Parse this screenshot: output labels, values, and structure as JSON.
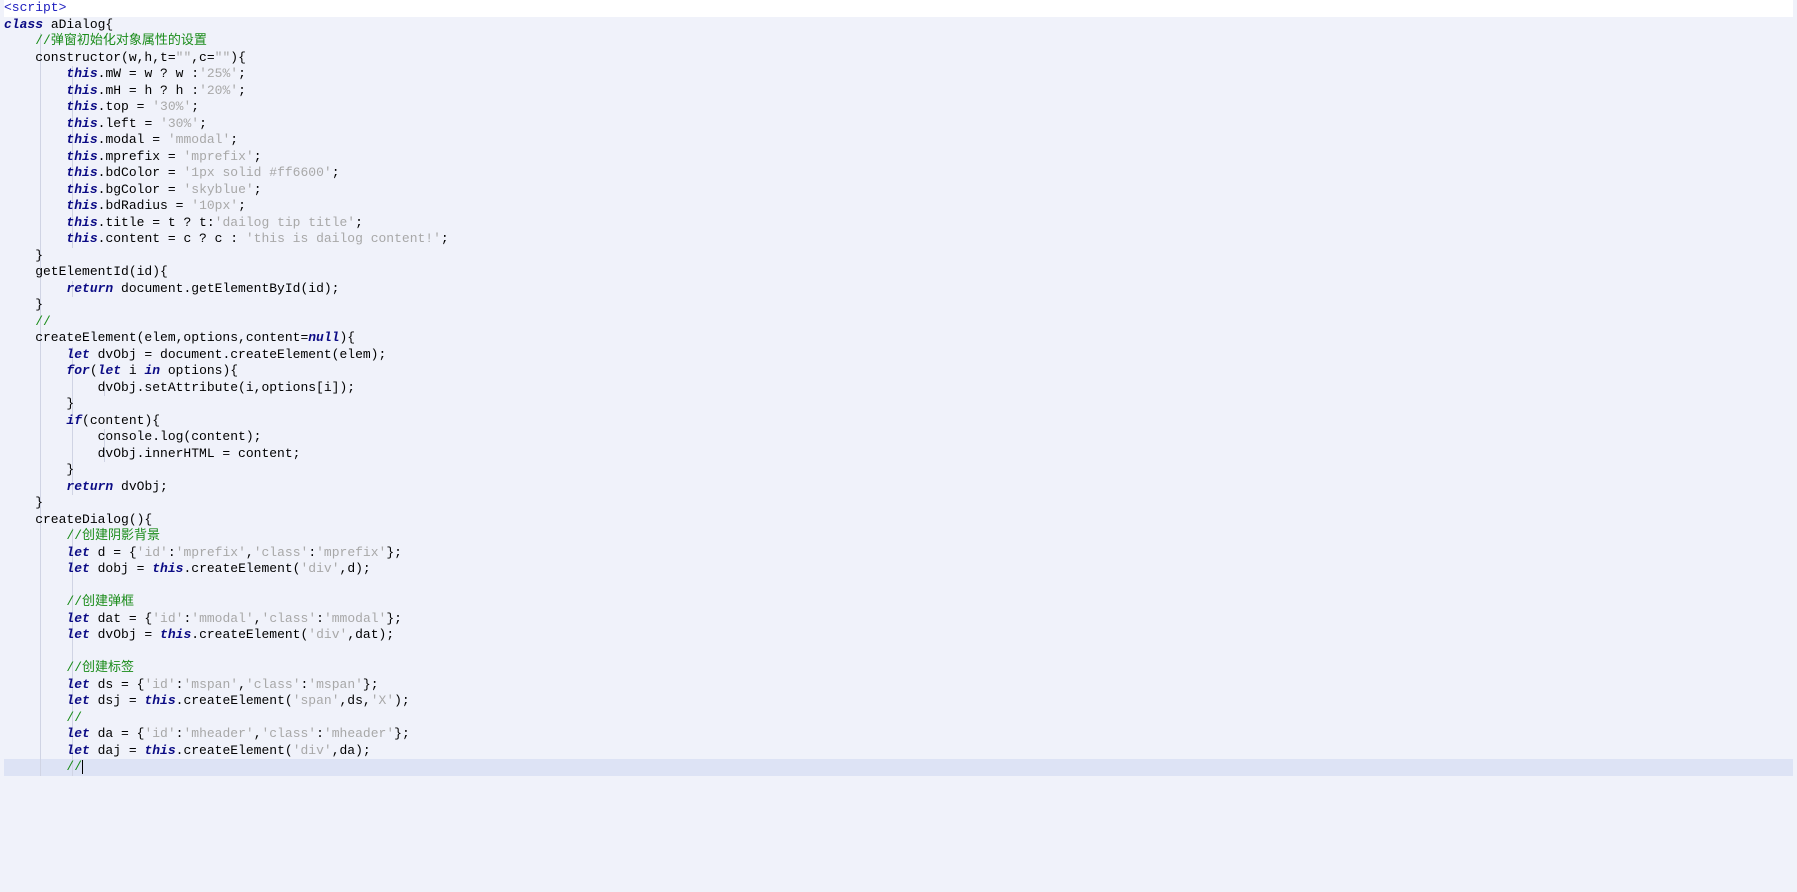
{
  "lines": [
    {
      "bg": "top",
      "guides": [],
      "frags": [
        {
          "cls": "tag",
          "t": "<script>"
        }
      ]
    },
    {
      "guides": [],
      "frags": [
        {
          "cls": "kw",
          "t": "class"
        },
        {
          "cls": "plain",
          "t": " aDialog{"
        }
      ]
    },
    {
      "guides": [
        1
      ],
      "frags": [
        {
          "cls": "plain",
          "t": "    "
        },
        {
          "cls": "cmt",
          "t": "//弹窗初始化对象属性的设置"
        }
      ]
    },
    {
      "guides": [
        1
      ],
      "frags": [
        {
          "cls": "plain",
          "t": "    constructor(w,h,t="
        },
        {
          "cls": "str",
          "t": "\"\""
        },
        {
          "cls": "plain",
          "t": ",c="
        },
        {
          "cls": "str",
          "t": "\"\""
        },
        {
          "cls": "plain",
          "t": "){"
        }
      ]
    },
    {
      "guides": [
        1,
        2
      ],
      "frags": [
        {
          "cls": "plain",
          "t": "        "
        },
        {
          "cls": "kw",
          "t": "this"
        },
        {
          "cls": "plain",
          "t": ".mW = w ? w :"
        },
        {
          "cls": "str",
          "t": "'25%'"
        },
        {
          "cls": "plain",
          "t": ";"
        }
      ]
    },
    {
      "guides": [
        1,
        2
      ],
      "frags": [
        {
          "cls": "plain",
          "t": "        "
        },
        {
          "cls": "kw",
          "t": "this"
        },
        {
          "cls": "plain",
          "t": ".mH = h ? h :"
        },
        {
          "cls": "str",
          "t": "'20%'"
        },
        {
          "cls": "plain",
          "t": ";"
        }
      ]
    },
    {
      "guides": [
        1,
        2
      ],
      "frags": [
        {
          "cls": "plain",
          "t": "        "
        },
        {
          "cls": "kw",
          "t": "this"
        },
        {
          "cls": "plain",
          "t": ".top = "
        },
        {
          "cls": "str",
          "t": "'30%'"
        },
        {
          "cls": "plain",
          "t": ";"
        }
      ]
    },
    {
      "guides": [
        1,
        2
      ],
      "frags": [
        {
          "cls": "plain",
          "t": "        "
        },
        {
          "cls": "kw",
          "t": "this"
        },
        {
          "cls": "plain",
          "t": ".left = "
        },
        {
          "cls": "str",
          "t": "'30%'"
        },
        {
          "cls": "plain",
          "t": ";"
        }
      ]
    },
    {
      "guides": [
        1,
        2
      ],
      "frags": [
        {
          "cls": "plain",
          "t": "        "
        },
        {
          "cls": "kw",
          "t": "this"
        },
        {
          "cls": "plain",
          "t": ".modal = "
        },
        {
          "cls": "str",
          "t": "'mmodal'"
        },
        {
          "cls": "plain",
          "t": ";"
        }
      ]
    },
    {
      "guides": [
        1,
        2
      ],
      "frags": [
        {
          "cls": "plain",
          "t": "        "
        },
        {
          "cls": "kw",
          "t": "this"
        },
        {
          "cls": "plain",
          "t": ".mprefix = "
        },
        {
          "cls": "str",
          "t": "'mprefix'"
        },
        {
          "cls": "plain",
          "t": ";"
        }
      ]
    },
    {
      "guides": [
        1,
        2
      ],
      "frags": [
        {
          "cls": "plain",
          "t": "        "
        },
        {
          "cls": "kw",
          "t": "this"
        },
        {
          "cls": "plain",
          "t": ".bdColor = "
        },
        {
          "cls": "str",
          "t": "'1px solid #ff6600'"
        },
        {
          "cls": "plain",
          "t": ";"
        }
      ]
    },
    {
      "guides": [
        1,
        2
      ],
      "frags": [
        {
          "cls": "plain",
          "t": "        "
        },
        {
          "cls": "kw",
          "t": "this"
        },
        {
          "cls": "plain",
          "t": ".bgColor = "
        },
        {
          "cls": "str",
          "t": "'skyblue'"
        },
        {
          "cls": "plain",
          "t": ";"
        }
      ]
    },
    {
      "guides": [
        1,
        2
      ],
      "frags": [
        {
          "cls": "plain",
          "t": "        "
        },
        {
          "cls": "kw",
          "t": "this"
        },
        {
          "cls": "plain",
          "t": ".bdRadius = "
        },
        {
          "cls": "str",
          "t": "'10px'"
        },
        {
          "cls": "plain",
          "t": ";"
        }
      ]
    },
    {
      "guides": [
        1,
        2
      ],
      "frags": [
        {
          "cls": "plain",
          "t": "        "
        },
        {
          "cls": "kw",
          "t": "this"
        },
        {
          "cls": "plain",
          "t": ".title = t ? t:"
        },
        {
          "cls": "str",
          "t": "'dailog tip title'"
        },
        {
          "cls": "plain",
          "t": ";"
        }
      ]
    },
    {
      "guides": [
        1,
        2
      ],
      "frags": [
        {
          "cls": "plain",
          "t": "        "
        },
        {
          "cls": "kw",
          "t": "this"
        },
        {
          "cls": "plain",
          "t": ".content = c ? c : "
        },
        {
          "cls": "str",
          "t": "'this is dailog content!'"
        },
        {
          "cls": "plain",
          "t": ";"
        }
      ]
    },
    {
      "guides": [
        1
      ],
      "frags": [
        {
          "cls": "plain",
          "t": "    }"
        }
      ]
    },
    {
      "guides": [
        1
      ],
      "frags": [
        {
          "cls": "plain",
          "t": "    getElementId(id){"
        }
      ]
    },
    {
      "guides": [
        1,
        2
      ],
      "frags": [
        {
          "cls": "plain",
          "t": "        "
        },
        {
          "cls": "kw",
          "t": "return"
        },
        {
          "cls": "plain",
          "t": " document.getElementById(id);"
        }
      ]
    },
    {
      "guides": [
        1
      ],
      "frags": [
        {
          "cls": "plain",
          "t": "    }"
        }
      ]
    },
    {
      "guides": [
        1
      ],
      "frags": [
        {
          "cls": "plain",
          "t": "    "
        },
        {
          "cls": "cmt",
          "t": "//"
        }
      ]
    },
    {
      "guides": [
        1
      ],
      "frags": [
        {
          "cls": "plain",
          "t": "    createElement(elem,options,content="
        },
        {
          "cls": "kw",
          "t": "null"
        },
        {
          "cls": "plain",
          "t": "){"
        }
      ]
    },
    {
      "guides": [
        1,
        2
      ],
      "frags": [
        {
          "cls": "plain",
          "t": "        "
        },
        {
          "cls": "kw",
          "t": "let"
        },
        {
          "cls": "plain",
          "t": " dvObj = document.createElement(elem);"
        }
      ]
    },
    {
      "guides": [
        1,
        2
      ],
      "frags": [
        {
          "cls": "plain",
          "t": "        "
        },
        {
          "cls": "kw",
          "t": "for"
        },
        {
          "cls": "plain",
          "t": "("
        },
        {
          "cls": "kw",
          "t": "let"
        },
        {
          "cls": "plain",
          "t": " i "
        },
        {
          "cls": "kw",
          "t": "in"
        },
        {
          "cls": "plain",
          "t": " options){"
        }
      ]
    },
    {
      "guides": [
        1,
        2,
        3
      ],
      "frags": [
        {
          "cls": "plain",
          "t": "            dvObj.setAttribute(i,options[i]);"
        }
      ]
    },
    {
      "guides": [
        1,
        2
      ],
      "frags": [
        {
          "cls": "plain",
          "t": "        }"
        }
      ]
    },
    {
      "guides": [
        1,
        2
      ],
      "frags": [
        {
          "cls": "plain",
          "t": "        "
        },
        {
          "cls": "kw",
          "t": "if"
        },
        {
          "cls": "plain",
          "t": "(content){"
        }
      ]
    },
    {
      "guides": [
        1,
        2,
        3
      ],
      "frags": [
        {
          "cls": "plain",
          "t": "            console.log(content);"
        }
      ]
    },
    {
      "guides": [
        1,
        2,
        3
      ],
      "frags": [
        {
          "cls": "plain",
          "t": "            dvObj.innerHTML = content;"
        }
      ]
    },
    {
      "guides": [
        1,
        2
      ],
      "frags": [
        {
          "cls": "plain",
          "t": "        }"
        }
      ]
    },
    {
      "guides": [
        1,
        2
      ],
      "frags": [
        {
          "cls": "plain",
          "t": "        "
        },
        {
          "cls": "kw",
          "t": "return"
        },
        {
          "cls": "plain",
          "t": " dvObj;"
        }
      ]
    },
    {
      "guides": [
        1
      ],
      "frags": [
        {
          "cls": "plain",
          "t": "    }"
        }
      ]
    },
    {
      "guides": [
        1
      ],
      "frags": [
        {
          "cls": "plain",
          "t": "    createDialog(){"
        }
      ]
    },
    {
      "guides": [
        1,
        2
      ],
      "frags": [
        {
          "cls": "plain",
          "t": "        "
        },
        {
          "cls": "cmt",
          "t": "//创建阴影背景"
        }
      ]
    },
    {
      "guides": [
        1,
        2
      ],
      "frags": [
        {
          "cls": "plain",
          "t": "        "
        },
        {
          "cls": "kw",
          "t": "let"
        },
        {
          "cls": "plain",
          "t": " d = {"
        },
        {
          "cls": "str",
          "t": "'id'"
        },
        {
          "cls": "plain",
          "t": ":"
        },
        {
          "cls": "str",
          "t": "'mprefix'"
        },
        {
          "cls": "plain",
          "t": ","
        },
        {
          "cls": "str",
          "t": "'class'"
        },
        {
          "cls": "plain",
          "t": ":"
        },
        {
          "cls": "str",
          "t": "'mprefix'"
        },
        {
          "cls": "plain",
          "t": "};"
        }
      ]
    },
    {
      "guides": [
        1,
        2
      ],
      "frags": [
        {
          "cls": "plain",
          "t": "        "
        },
        {
          "cls": "kw",
          "t": "let"
        },
        {
          "cls": "plain",
          "t": " dobj = "
        },
        {
          "cls": "kw",
          "t": "this"
        },
        {
          "cls": "plain",
          "t": ".createElement("
        },
        {
          "cls": "str",
          "t": "'div'"
        },
        {
          "cls": "plain",
          "t": ",d);"
        }
      ]
    },
    {
      "guides": [
        1,
        2
      ],
      "frags": [
        {
          "cls": "plain",
          "t": "        "
        }
      ]
    },
    {
      "guides": [
        1,
        2
      ],
      "frags": [
        {
          "cls": "plain",
          "t": "        "
        },
        {
          "cls": "cmt",
          "t": "//创建弹框"
        }
      ]
    },
    {
      "guides": [
        1,
        2
      ],
      "frags": [
        {
          "cls": "plain",
          "t": "        "
        },
        {
          "cls": "kw",
          "t": "let"
        },
        {
          "cls": "plain",
          "t": " dat = {"
        },
        {
          "cls": "str",
          "t": "'id'"
        },
        {
          "cls": "plain",
          "t": ":"
        },
        {
          "cls": "str",
          "t": "'mmodal'"
        },
        {
          "cls": "plain",
          "t": ","
        },
        {
          "cls": "str",
          "t": "'class'"
        },
        {
          "cls": "plain",
          "t": ":"
        },
        {
          "cls": "str",
          "t": "'mmodal'"
        },
        {
          "cls": "plain",
          "t": "};"
        }
      ]
    },
    {
      "guides": [
        1,
        2
      ],
      "frags": [
        {
          "cls": "plain",
          "t": "        "
        },
        {
          "cls": "kw",
          "t": "let"
        },
        {
          "cls": "plain",
          "t": " dvObj = "
        },
        {
          "cls": "kw",
          "t": "this"
        },
        {
          "cls": "plain",
          "t": ".createElement("
        },
        {
          "cls": "str",
          "t": "'div'"
        },
        {
          "cls": "plain",
          "t": ",dat);"
        }
      ]
    },
    {
      "guides": [
        1,
        2
      ],
      "frags": [
        {
          "cls": "plain",
          "t": "        "
        }
      ]
    },
    {
      "guides": [
        1,
        2
      ],
      "frags": [
        {
          "cls": "plain",
          "t": "        "
        },
        {
          "cls": "cmt",
          "t": "//创建标签"
        }
      ]
    },
    {
      "guides": [
        1,
        2
      ],
      "frags": [
        {
          "cls": "plain",
          "t": "        "
        },
        {
          "cls": "kw",
          "t": "let"
        },
        {
          "cls": "plain",
          "t": " ds = {"
        },
        {
          "cls": "str",
          "t": "'id'"
        },
        {
          "cls": "plain",
          "t": ":"
        },
        {
          "cls": "str",
          "t": "'mspan'"
        },
        {
          "cls": "plain",
          "t": ","
        },
        {
          "cls": "str",
          "t": "'class'"
        },
        {
          "cls": "plain",
          "t": ":"
        },
        {
          "cls": "str",
          "t": "'mspan'"
        },
        {
          "cls": "plain",
          "t": "};"
        }
      ]
    },
    {
      "guides": [
        1,
        2
      ],
      "frags": [
        {
          "cls": "plain",
          "t": "        "
        },
        {
          "cls": "kw",
          "t": "let"
        },
        {
          "cls": "plain",
          "t": " dsj = "
        },
        {
          "cls": "kw",
          "t": "this"
        },
        {
          "cls": "plain",
          "t": ".createElement("
        },
        {
          "cls": "str",
          "t": "'span'"
        },
        {
          "cls": "plain",
          "t": ",ds,"
        },
        {
          "cls": "str",
          "t": "'X'"
        },
        {
          "cls": "plain",
          "t": ");"
        }
      ]
    },
    {
      "guides": [
        1,
        2
      ],
      "frags": [
        {
          "cls": "plain",
          "t": "        "
        },
        {
          "cls": "cmt",
          "t": "//"
        }
      ]
    },
    {
      "guides": [
        1,
        2
      ],
      "frags": [
        {
          "cls": "plain",
          "t": "        "
        },
        {
          "cls": "kw",
          "t": "let"
        },
        {
          "cls": "plain",
          "t": " da = {"
        },
        {
          "cls": "str",
          "t": "'id'"
        },
        {
          "cls": "plain",
          "t": ":"
        },
        {
          "cls": "str",
          "t": "'mheader'"
        },
        {
          "cls": "plain",
          "t": ","
        },
        {
          "cls": "str",
          "t": "'class'"
        },
        {
          "cls": "plain",
          "t": ":"
        },
        {
          "cls": "str",
          "t": "'mheader'"
        },
        {
          "cls": "plain",
          "t": "};"
        }
      ]
    },
    {
      "guides": [
        1,
        2
      ],
      "frags": [
        {
          "cls": "plain",
          "t": "        "
        },
        {
          "cls": "kw",
          "t": "let"
        },
        {
          "cls": "plain",
          "t": " daj = "
        },
        {
          "cls": "kw",
          "t": "this"
        },
        {
          "cls": "plain",
          "t": ".createElement("
        },
        {
          "cls": "str",
          "t": "'div'"
        },
        {
          "cls": "plain",
          "t": ",da);"
        }
      ]
    },
    {
      "bg": "cursor",
      "guides": [
        1,
        2
      ],
      "frags": [
        {
          "cls": "plain",
          "t": "        "
        },
        {
          "cls": "cmt",
          "t": "//"
        }
      ],
      "caret": true
    }
  ]
}
